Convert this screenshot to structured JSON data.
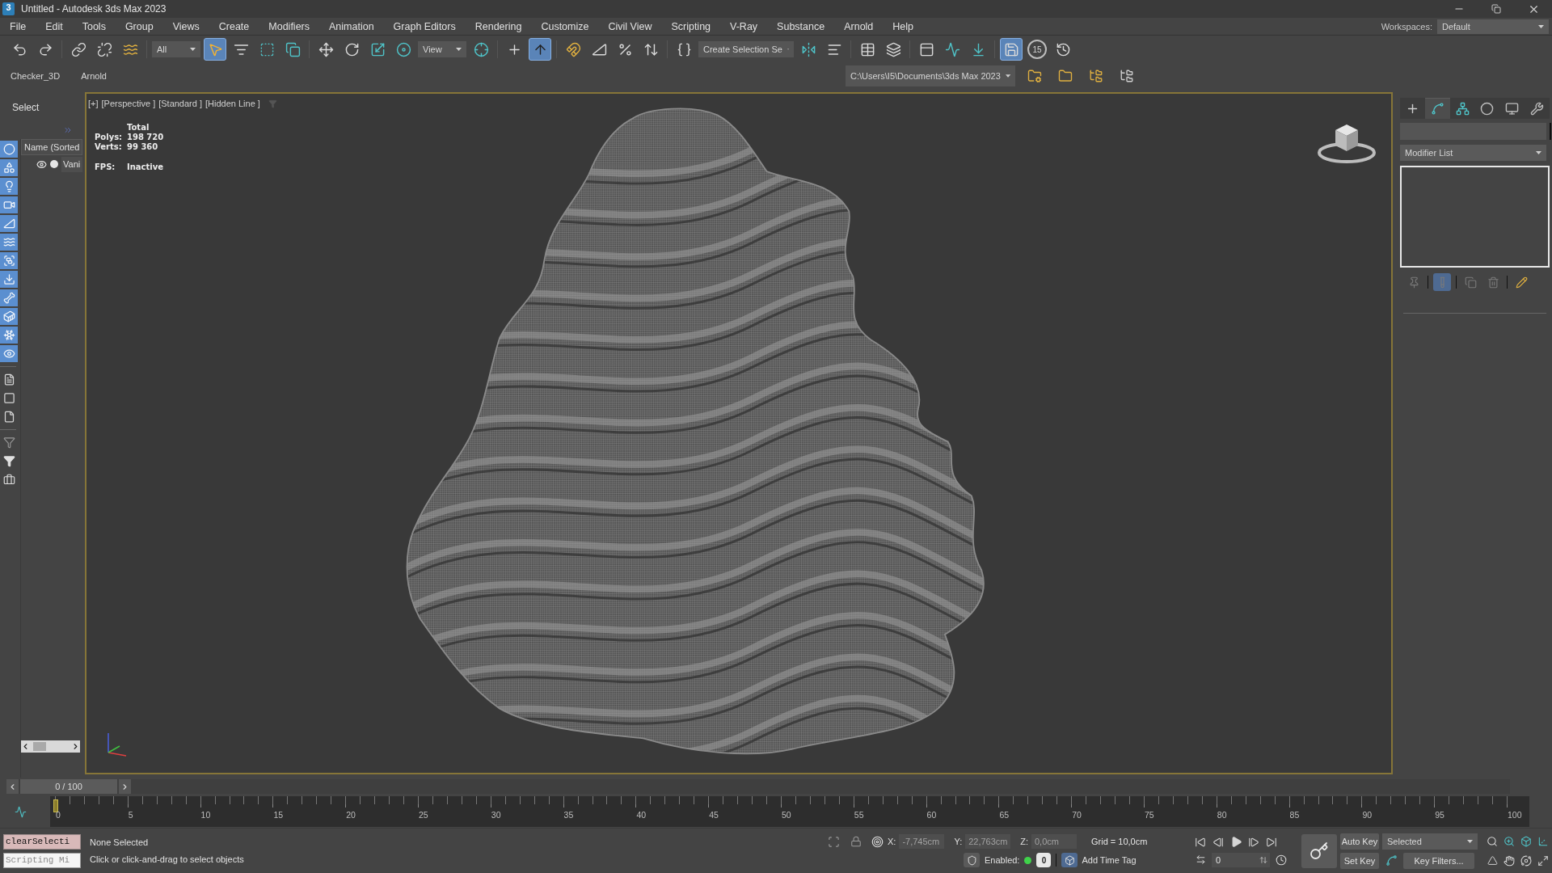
{
  "window": {
    "logo": "3",
    "title": "Untitled - Autodesk 3ds Max 2023"
  },
  "menu": [
    "File",
    "Edit",
    "Tools",
    "Group",
    "Views",
    "Create",
    "Modifiers",
    "Animation",
    "Graph Editors",
    "Rendering",
    "Customize",
    "Civil View",
    "Scripting",
    "V-Ray",
    "Substance",
    "Arnold",
    "Help"
  ],
  "workspaces": {
    "label": "Workspaces:",
    "value": "Default"
  },
  "main_toolbar": [
    {
      "kind": "button",
      "active": false
    },
    {
      "kind": "button",
      "active": false
    },
    {
      "kind": "separator"
    },
    {
      "kind": "button",
      "active": false
    },
    {
      "kind": "button",
      "active": false
    },
    {
      "kind": "button",
      "active": false
    },
    {
      "kind": "separator"
    },
    {
      "kind": "dropdown",
      "value": "All"
    },
    {
      "kind": "button",
      "active": true
    },
    {
      "kind": "button",
      "active": false
    },
    {
      "kind": "button",
      "active": false
    },
    {
      "kind": "button",
      "active": false
    },
    {
      "kind": "separator"
    },
    {
      "kind": "button",
      "active": false
    },
    {
      "kind": "button",
      "active": false
    },
    {
      "kind": "button",
      "active": false
    },
    {
      "kind": "button",
      "active": false
    },
    {
      "kind": "dropdown",
      "value": "View"
    },
    {
      "kind": "button",
      "active": false
    },
    {
      "kind": "separator"
    },
    {
      "kind": "button",
      "active": false
    },
    {
      "kind": "button",
      "active": true
    },
    {
      "kind": "separator"
    },
    {
      "kind": "button",
      "active": false
    },
    {
      "kind": "button",
      "active": false
    },
    {
      "kind": "button",
      "active": false
    },
    {
      "kind": "button",
      "active": false
    },
    {
      "kind": "separator"
    },
    {
      "kind": "button",
      "active": false
    },
    {
      "kind": "dropdown",
      "value": "Create Selection Se"
    },
    {
      "kind": "button",
      "active": false
    },
    {
      "kind": "button",
      "active": false
    },
    {
      "kind": "separator"
    },
    {
      "kind": "button",
      "active": false
    },
    {
      "kind": "button",
      "active": false
    },
    {
      "kind": "separator"
    },
    {
      "kind": "button",
      "active": false
    },
    {
      "kind": "button",
      "active": false
    },
    {
      "kind": "button",
      "active": false
    },
    {
      "kind": "separator"
    },
    {
      "kind": "button",
      "active": true
    },
    {
      "kind": "counter",
      "label": "15",
      "active": false
    },
    {
      "kind": "button",
      "active": false
    }
  ],
  "toolbar_tabs": [
    "Checker_3D",
    "Arnold"
  ],
  "project_path": "C:\\Users\\I5\\Documents\\3ds Max 2023",
  "scene_explorer": {
    "title": "Select",
    "column": "Name (Sorted",
    "rows": [
      {
        "name": "Vani",
        "visible": true
      }
    ]
  },
  "display_filters": [
    {
      "on": true
    },
    {
      "on": true
    },
    {
      "on": true
    },
    {
      "on": true
    },
    {
      "on": true
    },
    {
      "on": true
    },
    {
      "on": true
    },
    {
      "on": true
    },
    {
      "on": true
    },
    {
      "on": true
    },
    {
      "on": true
    },
    {
      "on": true
    },
    {
      "on": false
    },
    {
      "on": false
    },
    {
      "on": false
    }
  ],
  "viewport": {
    "labels": [
      "[+]",
      "[Perspective ]",
      "[Standard ]",
      "[Hidden Line ]"
    ],
    "stats": {
      "heading": "Total",
      "rows": [
        {
          "label": "Polys:",
          "value": "198 720"
        },
        {
          "label": "Verts:",
          "value": "99 360"
        }
      ],
      "fps_label": "FPS:",
      "fps_value": "Inactive"
    }
  },
  "command_panel": {
    "tabs": [
      {
        "selected": false
      },
      {
        "selected": true
      },
      {
        "selected": false
      },
      {
        "selected": false
      },
      {
        "selected": false
      },
      {
        "selected": false
      }
    ],
    "modifier_list": "Modifier List",
    "stack_buttons": [
      {
        "active": false
      },
      {
        "active": true
      },
      {
        "active": false
      },
      {
        "active": false
      },
      {
        "active": false
      }
    ]
  },
  "time_slider": {
    "label": "0 / 100",
    "level": 0
  },
  "trackbar": {
    "labels": [
      "0",
      "5",
      "10",
      "15",
      "20",
      "25",
      "30",
      "35",
      "40",
      "45",
      "50",
      "55",
      "60",
      "65",
      "70",
      "75",
      "80",
      "85",
      "90",
      "95",
      "100"
    ]
  },
  "listener": {
    "value": "clearSelecti",
    "placeholder": "Scripting Mi"
  },
  "prompt": {
    "status": "None Selected",
    "hint": "Click or click-and-drag to select objects"
  },
  "coordinates": [
    {
      "axis": "X:",
      "value": "-7,745cm",
      "disabled": true
    },
    {
      "axis": "Y:",
      "value": "22,763cm",
      "disabled": true
    },
    {
      "axis": "Z:",
      "value": "0,0cm",
      "disabled": true
    }
  ],
  "grid": "Grid = 10,0cm",
  "time_tag": {
    "enabled_label": "Enabled:",
    "enabled": true,
    "count": "0",
    "add_label": "Add Time Tag"
  },
  "animation": {
    "frame": "0",
    "auto_key": "Auto Key",
    "key_mode": "Selected",
    "set_key": "Set Key",
    "key_filters": "Key Filters..."
  }
}
